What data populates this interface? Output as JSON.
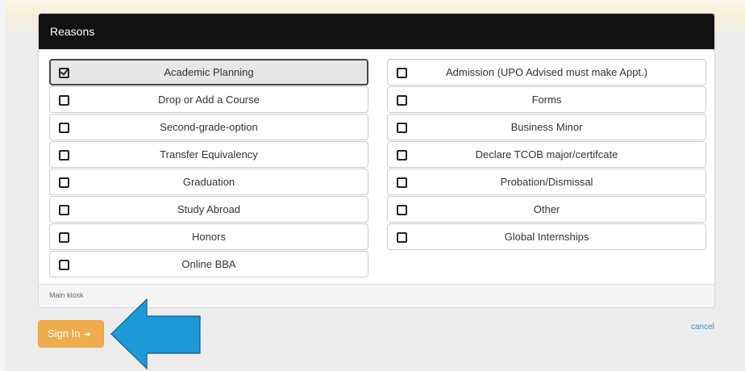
{
  "panel": {
    "title": "Reasons",
    "footer": "Main kiosk"
  },
  "reasons_left": [
    {
      "label": "Academic Planning",
      "checked": true
    },
    {
      "label": "Drop or Add a Course",
      "checked": false
    },
    {
      "label": "Second-grade-option",
      "checked": false
    },
    {
      "label": "Transfer Equivalency",
      "checked": false
    },
    {
      "label": "Graduation",
      "checked": false
    },
    {
      "label": "Study Abroad",
      "checked": false
    },
    {
      "label": "Honors",
      "checked": false
    },
    {
      "label": "Online BBA",
      "checked": false
    }
  ],
  "reasons_right": [
    {
      "label": "Admission (UPO Advised must make Appt.)",
      "checked": false
    },
    {
      "label": "Forms",
      "checked": false
    },
    {
      "label": "Business Minor",
      "checked": false
    },
    {
      "label": "Declare TCOB major/certifcate",
      "checked": false
    },
    {
      "label": "Probation/Dismissal",
      "checked": false
    },
    {
      "label": "Other",
      "checked": false
    },
    {
      "label": "Global Internships",
      "checked": false
    }
  ],
  "actions": {
    "signin_label": "Sign In",
    "signin_icon": "sign-in-icon",
    "cancel_label": "cancel"
  },
  "colors": {
    "header_bg": "#111111",
    "signin_bg": "#f0ad4e",
    "arrow": "#1e9ad6",
    "link": "#428bca"
  }
}
